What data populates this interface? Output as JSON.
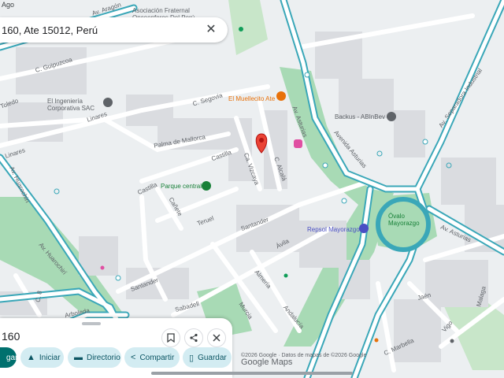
{
  "status": {
    "fragment": "Ago"
  },
  "search": {
    "query": "160, Ate 15012, Perú",
    "clear_label": "✕"
  },
  "map": {
    "streets": [
      "Av. Aragón",
      "C. Guipuzcoa",
      "C. Segovia",
      "Toledo",
      "Linares",
      "Linares",
      "Palma de Mallorca",
      "Castilla",
      "Castilla",
      "Ca. Vizcaya",
      "C. Alcalá",
      "Av. Asturias",
      "Avenida Asturias",
      "Av. Separadora Industrial",
      "Av. Asturias",
      "Teruel",
      "Cañete",
      "Santander",
      "Santander",
      "Ávila",
      "Almería",
      "Av. Huarochirí",
      "Av. Huarochirí",
      "C. 8",
      "Sabadell",
      "Murcia",
      "Andalucía",
      "Jaén",
      "C. Marbella",
      "Vigo",
      "Malaga",
      "Arboleda"
    ],
    "pois": [
      {
        "name": "Asociación Fraternal Oncoenferos Del Perú",
        "color": "#5f6368"
      },
      {
        "name": "El Ingeniería Corporativa SAC",
        "color": "#5f6368"
      },
      {
        "name": "El Muellecito Ate",
        "color": "#e8710a"
      },
      {
        "name": "Backus - ABInBev",
        "color": "#5f6368"
      },
      {
        "name": "Parque central",
        "color": "#188038"
      },
      {
        "name": "Óvalo Mayorazgo",
        "color": "#188038"
      },
      {
        "name": "Repsol Mayorazgo",
        "color": "#4a4fc4"
      }
    ]
  },
  "sheet": {
    "title": "160",
    "actions": {
      "save_icon": "bookmark",
      "share_icon": "share",
      "close_icon": "close"
    },
    "buttons": [
      {
        "label": "gar",
        "icon": ""
      },
      {
        "label": "Iniciar",
        "icon": "▲"
      },
      {
        "label": "Directorio",
        "icon": "▬"
      },
      {
        "label": "Compartir",
        "icon": "<"
      },
      {
        "label": "Guardar",
        "icon": "▯"
      }
    ]
  },
  "footer": {
    "copyright": "©2026 Google · Datos de mapas de ©2026 Google",
    "logo": "Google Maps"
  },
  "colors": {
    "road": "#ffffff",
    "major_road_border": "#3aa7b8",
    "park": "#a8dab5",
    "block": "#dadce0",
    "pin": "#ea4335",
    "accent": "#00706e"
  }
}
